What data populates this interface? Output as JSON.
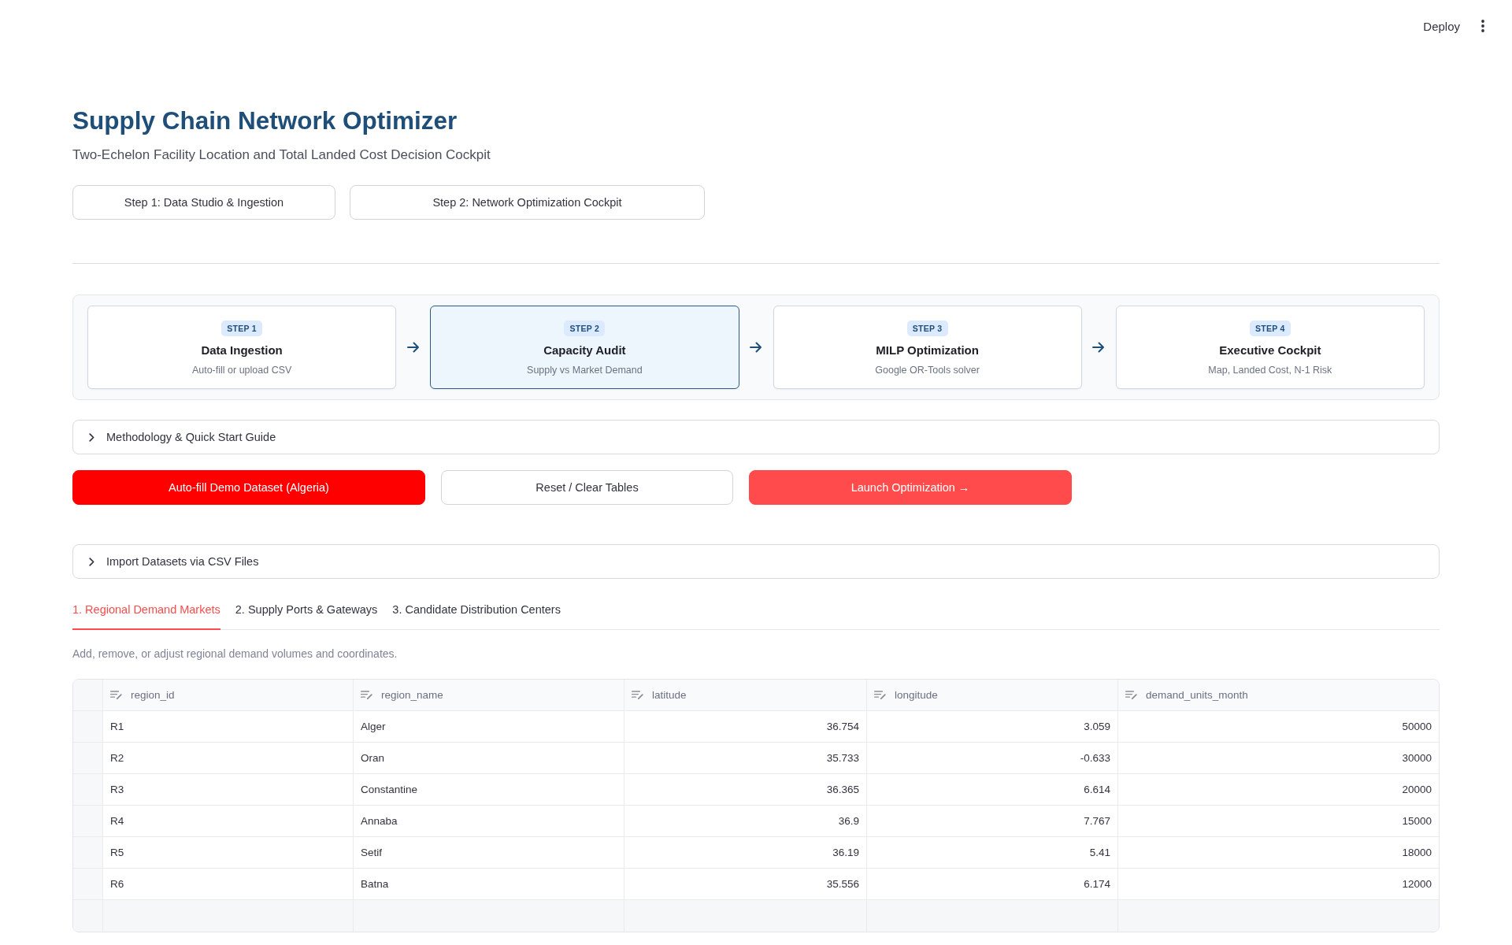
{
  "top_bar": {
    "deploy_label": "Deploy"
  },
  "header": {
    "title": "Supply Chain Network Optimizer",
    "subtitle": "Two-Echelon Facility Location and Total Landed Cost Decision Cockpit"
  },
  "page_buttons": [
    {
      "label": "Step 1: Data Studio & Ingestion"
    },
    {
      "label": "Step 2: Network Optimization Cockpit"
    }
  ],
  "workflow_steps": [
    {
      "badge": "STEP 1",
      "title": "Data Ingestion",
      "subtitle": "Auto-fill or upload CSV",
      "selected": false
    },
    {
      "badge": "STEP 2",
      "title": "Capacity Audit",
      "subtitle": "Supply vs Market Demand",
      "selected": true
    },
    {
      "badge": "STEP 3",
      "title": "MILP Optimization",
      "subtitle": "Google OR-Tools solver",
      "selected": false
    },
    {
      "badge": "STEP 4",
      "title": "Executive Cockpit",
      "subtitle": "Map, Landed Cost, N-1 Risk",
      "selected": false
    }
  ],
  "methodology_expander": {
    "label": "Methodology & Quick Start Guide",
    "expanded": false
  },
  "actions": [
    {
      "label": "Auto-fill Demo Dataset (Algeria)",
      "kind": "primary"
    },
    {
      "label": "Reset / Clear Tables",
      "kind": "secondary"
    },
    {
      "label": "Launch Optimization →",
      "kind": "accent"
    }
  ],
  "import_expander": {
    "label": "Import Datasets via CSV Files",
    "expanded": false
  },
  "data_tabs": [
    {
      "label": "1. Regional Demand Markets",
      "selected": true
    },
    {
      "label": "2. Supply Ports & Gateways",
      "selected": false
    },
    {
      "label": "3. Candidate Distribution Centers",
      "selected": false
    }
  ],
  "caption": "Add, remove, or adjust regional demand volumes and coordinates.",
  "table": {
    "columns": [
      {
        "label": "region_id",
        "kind": "text"
      },
      {
        "label": "region_name",
        "kind": "text"
      },
      {
        "label": "latitude",
        "kind": "number"
      },
      {
        "label": "longitude",
        "kind": "number"
      },
      {
        "label": "demand_units_month",
        "kind": "number"
      }
    ],
    "rows": [
      [
        "R1",
        "Alger",
        "36.754",
        "3.059",
        "50000"
      ],
      [
        "R2",
        "Oran",
        "35.733",
        "-0.633",
        "30000"
      ],
      [
        "R3",
        "Constantine",
        "36.365",
        "6.614",
        "20000"
      ],
      [
        "R4",
        "Annaba",
        "36.9",
        "7.767",
        "15000"
      ],
      [
        "R5",
        "Setif",
        "36.19",
        "5.41",
        "18000"
      ],
      [
        "R6",
        "Batna",
        "35.556",
        "6.174",
        "12000"
      ]
    ]
  }
}
